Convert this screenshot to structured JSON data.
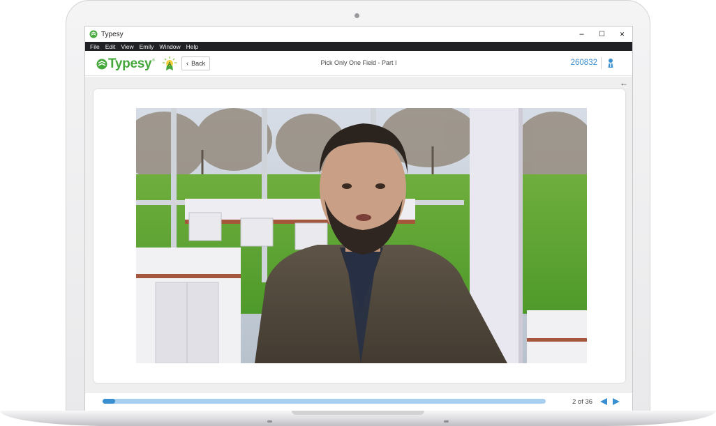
{
  "window": {
    "title": "Typesy",
    "minimize": "–",
    "maximize": "☐",
    "close": "✕"
  },
  "menu": [
    "File",
    "Edit",
    "View",
    "Emily",
    "Window",
    "Help"
  ],
  "header": {
    "brand": "Typesy",
    "brand_tm": "®",
    "back_label": "Back",
    "lesson_title": "Pick Only One Field - Part I",
    "user_id": "260832"
  },
  "footer": {
    "page_indicator": "2 of 36",
    "progress_fraction": 0.028
  },
  "colors": {
    "brand_green": "#44a83a",
    "accent_blue": "#3a8fd0",
    "track_blue": "#a9cff0",
    "menubar": "#202124"
  },
  "icons": {
    "title_logo": "typesy-logo-icon",
    "award": "award-icon",
    "back": "chevron-left-icon",
    "profile": "user-profile-icon",
    "collapse": "arrow-left-icon",
    "prev": "triangle-left-icon",
    "next": "triangle-right-icon"
  }
}
